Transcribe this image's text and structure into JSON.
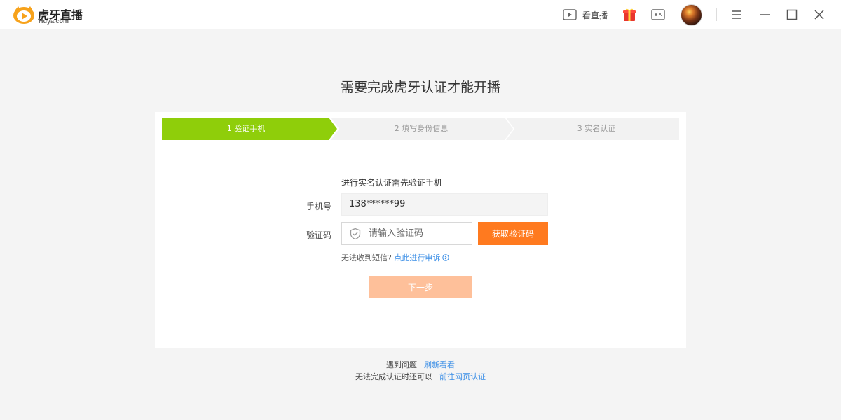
{
  "titlebar": {
    "brand_name": "虎牙直播",
    "brand_domain": "Huya.com",
    "watch_live_label": "看直播",
    "icons": [
      "video-play-icon",
      "gift-icon",
      "gamepad-icon",
      "avatar",
      "menu-icon",
      "minimize-icon",
      "maximize-icon",
      "close-icon"
    ]
  },
  "page": {
    "title": "需要完成虎牙认证才能开播"
  },
  "steps": [
    {
      "label": "1 验证手机",
      "active": true
    },
    {
      "label": "2 填写身份信息",
      "active": false
    },
    {
      "label": "3 实名认证",
      "active": false
    }
  ],
  "form": {
    "intro": "进行实名认证需先验证手机",
    "phone_label": "手机号",
    "phone_value": "138******99",
    "code_label": "验证码",
    "code_placeholder": "请输入验证码",
    "get_code_button": "获取验证码",
    "sms_help_text": "无法收到短信?",
    "appeal_link": "点此进行申诉",
    "next_button": "下一步"
  },
  "footer": {
    "problem_text": "遇到问题",
    "refresh_link": "刷新看看",
    "fallback_text": "无法完成认证时还可以",
    "web_verify_link": "前往网页认证"
  },
  "colors": {
    "step_active": "#8fce0a",
    "step_inactive": "#f2f2f2",
    "accent_orange": "#ff7a1f",
    "next_disabled": "#fec09a",
    "link_blue": "#3a8ee6",
    "brand_orange": "#f7a21b"
  }
}
